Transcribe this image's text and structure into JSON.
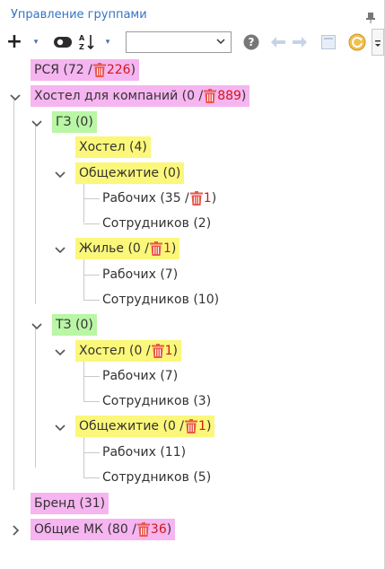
{
  "panel": {
    "title": "Управление группами"
  },
  "toolbar": {
    "add_label": "+",
    "dropdown_glyph": "▾",
    "filter_value": "",
    "icons": [
      "pin-icon",
      "plus-icon",
      "toggle-icon",
      "sort-az-icon",
      "help-icon",
      "arrow-left-icon",
      "arrow-right-icon",
      "window-icon",
      "refresh-icon",
      "more-icon"
    ]
  },
  "colors": {
    "pink": "#f6b5f0",
    "green": "#b9f6a5",
    "yellow": "#fbf77a",
    "trash": "#e8574b",
    "accent": "#3574c2",
    "deleted_count": "#d01818"
  },
  "tree": {
    "rsya": {
      "text": "РСЯ (72 / ",
      "deleted": "226",
      "close": ")"
    },
    "hostel_co": {
      "text": "Хостел для компаний (0 / ",
      "deleted": "889",
      "close": ")"
    },
    "gz": {
      "text": "ГЗ (0)"
    },
    "gz_hostel": {
      "text": "Хостел (4)"
    },
    "gz_dorm": {
      "text": "Общежитие (0)"
    },
    "gz_dorm_workers": {
      "text": "Рабочих (35 / ",
      "deleted": "1",
      "close": ")"
    },
    "gz_dorm_staff": {
      "text": "Сотрудников (2)"
    },
    "gz_housing": {
      "text": "Жилье (0 / ",
      "deleted": "1",
      "close": ")"
    },
    "gz_housing_workers": {
      "text": "Рабочих (7)"
    },
    "gz_housing_staff": {
      "text": "Сотрудников (10)"
    },
    "tz": {
      "text": "ТЗ (0)"
    },
    "tz_hostel": {
      "text": "Хостел (0 / ",
      "deleted": "1",
      "close": ")"
    },
    "tz_hostel_workers": {
      "text": "Рабочих (7)"
    },
    "tz_hostel_staff": {
      "text": "Сотрудников (3)"
    },
    "tz_dorm": {
      "text": "Общежитие (0 / ",
      "deleted": "1",
      "close": ")"
    },
    "tz_dorm_workers": {
      "text": "Рабочих (11)"
    },
    "tz_dorm_staff": {
      "text": "Сотрудников (5)"
    },
    "brand": {
      "text": "Бренд (31)"
    },
    "general_mk": {
      "text": "Общие МК (80 / ",
      "deleted": "36",
      "close": ")"
    }
  }
}
